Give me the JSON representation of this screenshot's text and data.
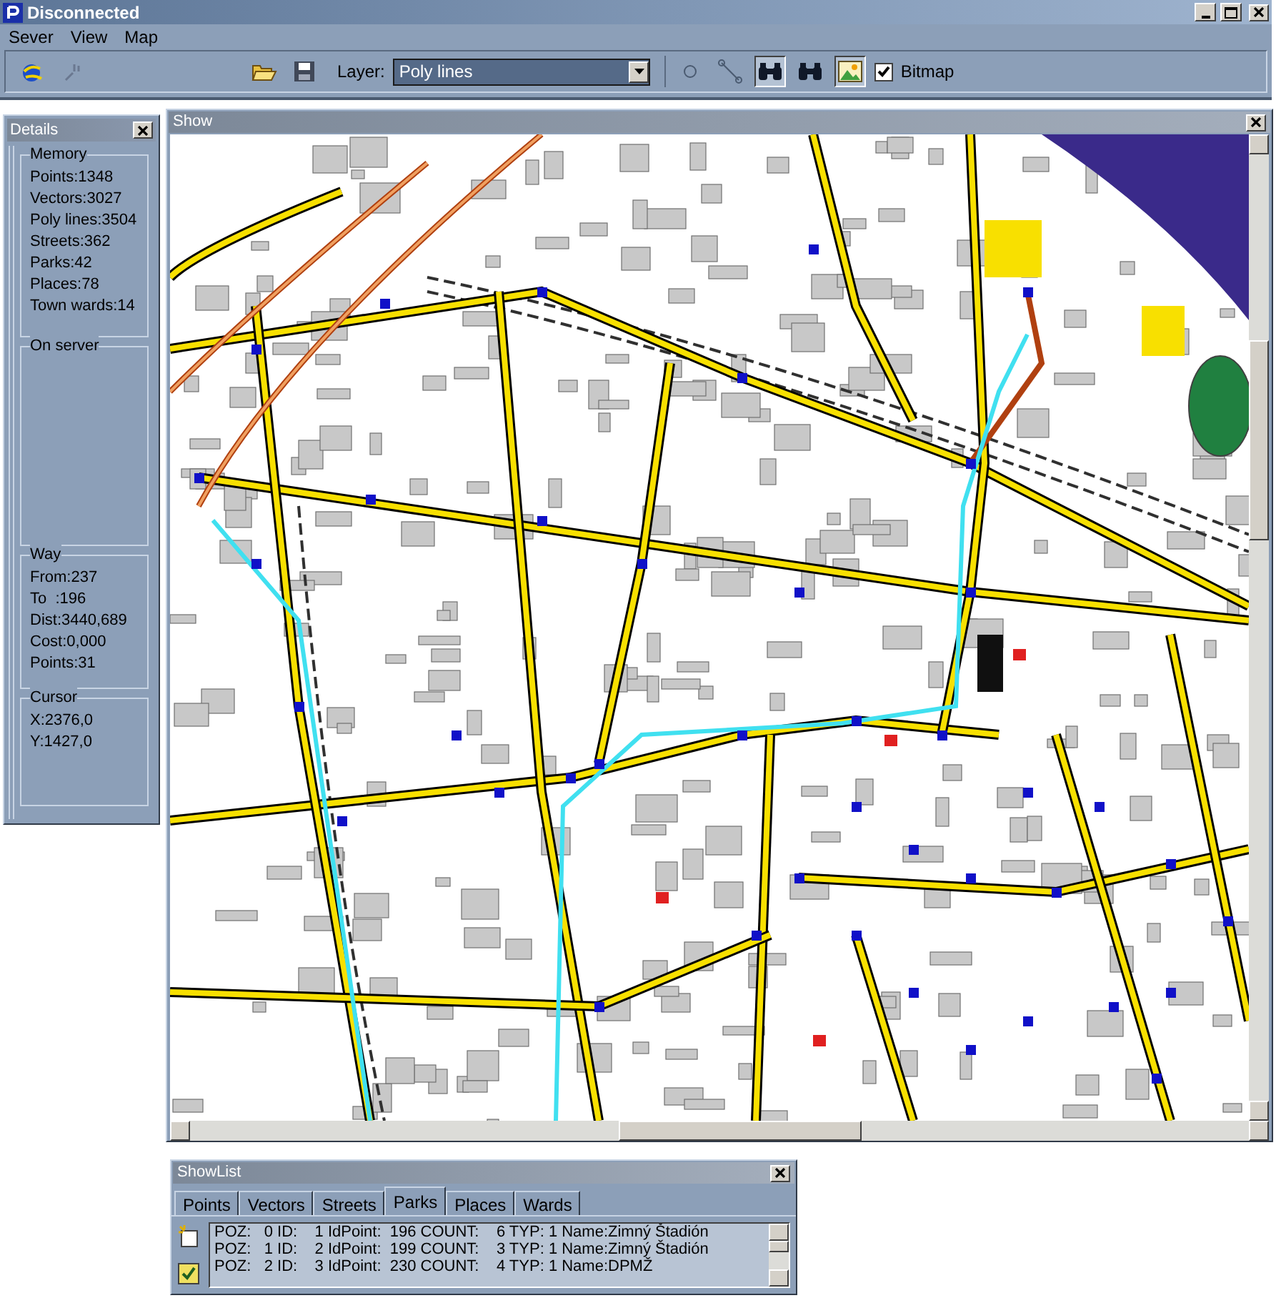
{
  "window": {
    "title": "Disconnected"
  },
  "menu": [
    "Sever",
    "View",
    "Map"
  ],
  "toolbar": {
    "layer_label": "Layer:",
    "layer_value": "Poly lines",
    "bitmap": {
      "label": "Bitmap",
      "checked": true
    }
  },
  "details": {
    "title": "Details",
    "groups": [
      {
        "title": "Memory",
        "lines": [
          "Points:1348",
          "Vectors:3027",
          "Poly lines:3504",
          "Streets:362",
          "Parks:42",
          "Places:78",
          "Town wards:14"
        ]
      },
      {
        "title": "On server"
      },
      {
        "title": "Way",
        "lines": [
          "From:237",
          "To  :196",
          "Dist:3440,689",
          "Cost:0,000",
          "Points:31"
        ]
      },
      {
        "title": "Cursor",
        "lines": [
          "X:2376,0",
          "Y:1427,0"
        ]
      }
    ]
  },
  "show": {
    "title": "Show"
  },
  "showlist": {
    "title": "ShowList",
    "tabs": [
      {
        "label": "Points",
        "selected": false
      },
      {
        "label": "Vectors",
        "selected": false
      },
      {
        "label": "Streets",
        "selected": false
      },
      {
        "label": "Parks",
        "selected": true
      },
      {
        "label": "Places",
        "selected": false
      },
      {
        "label": "Wards",
        "selected": false
      }
    ],
    "rows": [
      "POZ:   0 ID:    1 IdPoint:  196 COUNT:    6 TYP: 1 Name:Zimný Štadión",
      "POZ:   1 ID:    2 IdPoint:  199 COUNT:    3 TYP: 1 Name:Zimný Štadión",
      "POZ:   2 ID:    3 IdPoint:  230 COUNT:    4 TYP: 1 Name:DPMŽ"
    ]
  }
}
